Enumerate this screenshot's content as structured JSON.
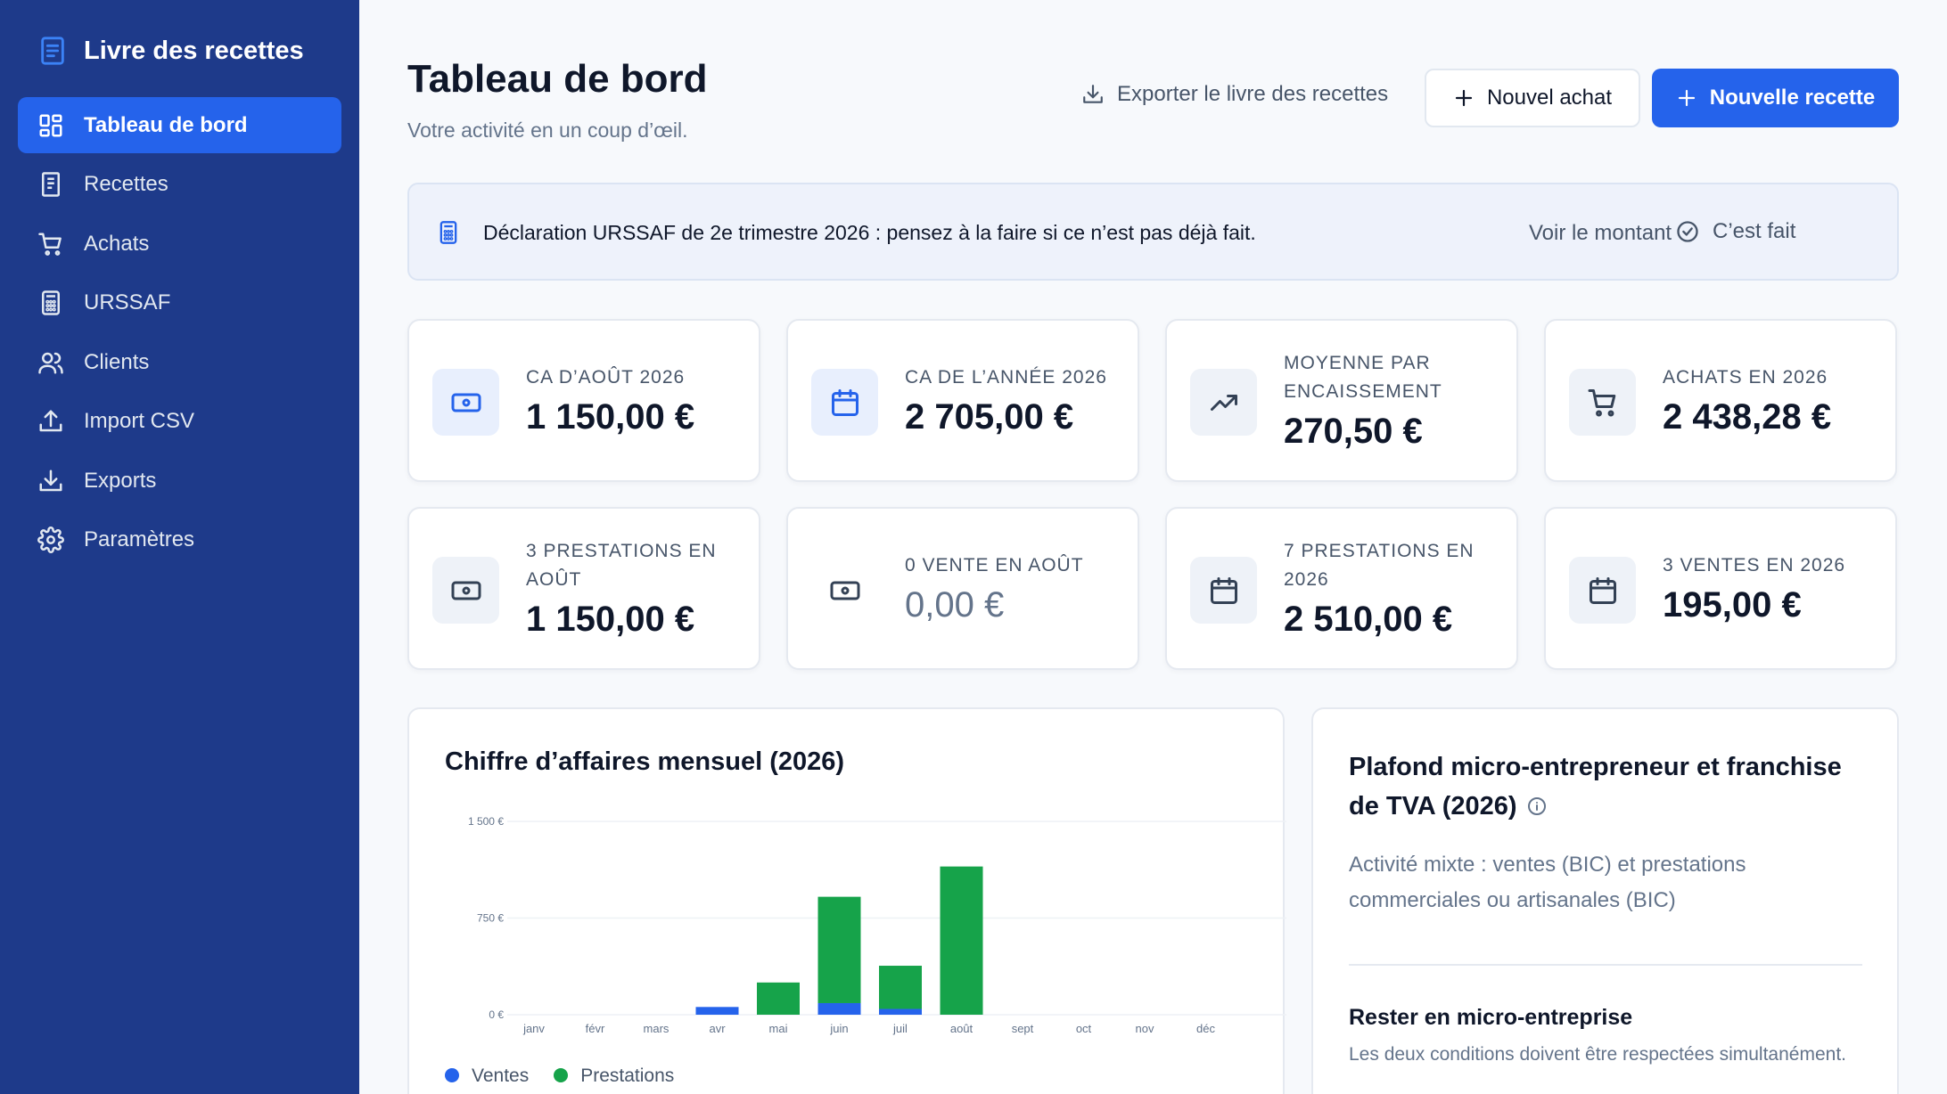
{
  "sidebar": {
    "brand": "Livre des recettes",
    "items": [
      {
        "label": "Tableau de bord",
        "icon": "dashboard-icon"
      },
      {
        "label": "Recettes",
        "icon": "receipt-icon"
      },
      {
        "label": "Achats",
        "icon": "cart-icon"
      },
      {
        "label": "URSSAF",
        "icon": "calculator-icon"
      },
      {
        "label": "Clients",
        "icon": "users-icon"
      },
      {
        "label": "Import CSV",
        "icon": "upload-icon"
      },
      {
        "label": "Exports",
        "icon": "download-icon"
      },
      {
        "label": "Paramètres",
        "icon": "gear-icon"
      }
    ]
  },
  "header": {
    "title": "Tableau de bord",
    "subtitle": "Votre activité en un coup d’œil.",
    "export_label": "Exporter le livre des recettes",
    "new_purchase_label": "Nouvel achat",
    "new_receipt_label": "Nouvelle recette"
  },
  "alert": {
    "text": "Déclaration URSSAF de 2e trimestre 2026 : pensez à la faire si ce n’est pas déjà fait.",
    "view_amount": "Voir le montant",
    "done": "C’est fait"
  },
  "cards": [
    {
      "label": "CA d’août 2026",
      "value": "1 150,00 €",
      "icon": "cash-icon"
    },
    {
      "label": "CA de l’année 2026",
      "value": "2 705,00 €",
      "icon": "calendar-icon"
    },
    {
      "label": "Moyenne par encaissement",
      "value": "270,50 €",
      "icon": "trending-up-icon"
    },
    {
      "label": "Achats en 2026",
      "value": "2 438,28 €",
      "icon": "cart-icon"
    },
    {
      "label": "3 prestations en août",
      "value": "1 150,00 €",
      "icon": "cash-icon"
    },
    {
      "label": "0 vente en août",
      "value": "0,00 €",
      "icon": "cash-icon"
    },
    {
      "label": "7 prestations en 2026",
      "value": "2 510,00 €",
      "icon": "calendar-icon"
    },
    {
      "label": "3 ventes en 2026",
      "value": "195,00 €",
      "icon": "calendar-icon"
    }
  ],
  "chart_data": {
    "type": "bar",
    "title": "Chiffre d’affaires mensuel (2026)",
    "stacked": true,
    "categories": [
      "janv",
      "févr",
      "mars",
      "avr",
      "mai",
      "juin",
      "juil",
      "août",
      "sept",
      "oct",
      "nov",
      "déc"
    ],
    "series": [
      {
        "name": "Ventes",
        "color": "#2563eb",
        "values": [
          0,
          0,
          0,
          60,
          0,
          90,
          45,
          0,
          0,
          0,
          0,
          0
        ]
      },
      {
        "name": "Prestations",
        "color": "#16a34a",
        "values": [
          0,
          0,
          0,
          0,
          250,
          825,
          335,
          1150,
          0,
          0,
          0,
          0
        ]
      }
    ],
    "yticks": [
      {
        "v": 0,
        "label": "0 €"
      },
      {
        "v": 750,
        "label": "750 €"
      },
      {
        "v": 1500,
        "label": "1 500 €"
      }
    ],
    "ylim": [
      0,
      1500
    ],
    "grid": true,
    "legend": "bottom-left"
  },
  "plafond": {
    "title": "Plafond micro-entrepreneur et franchise de TVA (2026)",
    "description": "Activité mixte : ventes (BIC) et prestations commerciales ou artisanales (BIC)",
    "subtitle": "Rester en micro-entreprise",
    "note": "Les deux conditions doivent être respectées simultanément."
  }
}
